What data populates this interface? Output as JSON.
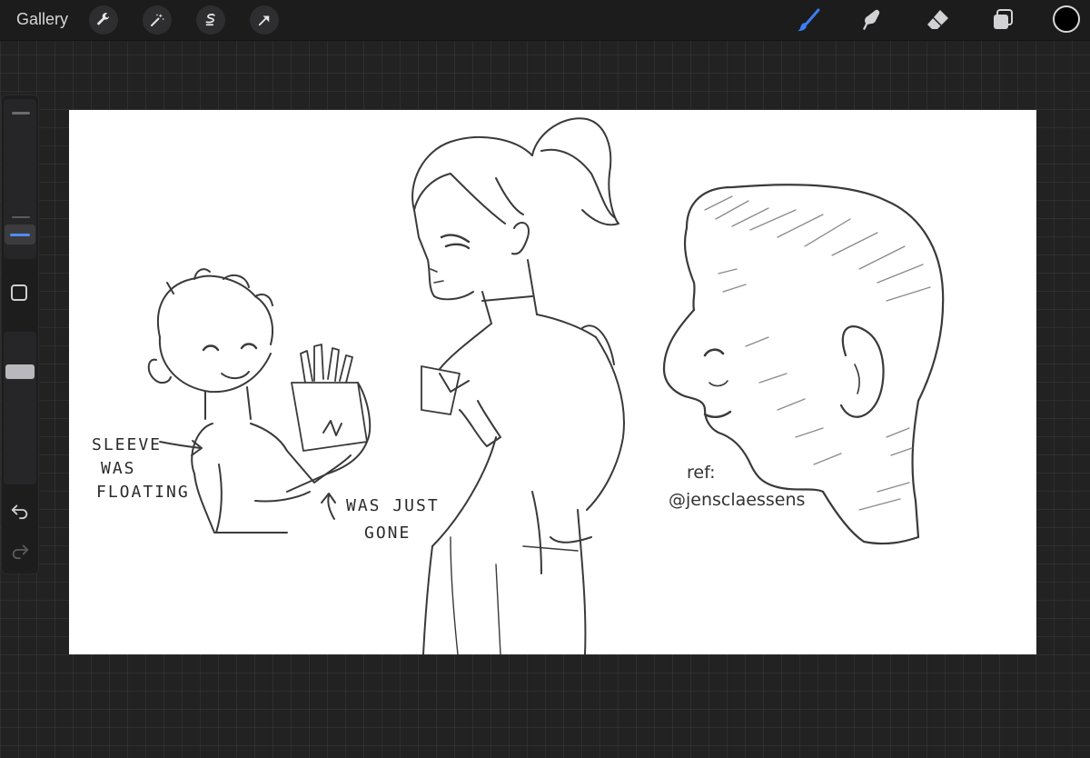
{
  "topbar": {
    "gallery_label": "Gallery",
    "left_tools": [
      "wrench-icon",
      "magic-wand-icon",
      "selection-icon",
      "transform-arrow-icon"
    ],
    "right_tools": [
      "brush-icon",
      "smudge-icon",
      "eraser-icon",
      "layers-icon"
    ],
    "active_tool": "brush",
    "accent_color": "#3c7ff0",
    "current_color": "#000000"
  },
  "sidebar": {
    "brush_size": 0.12,
    "brush_opacity": 0.82
  },
  "canvas": {
    "annotations": {
      "sleeve_line1": "SLEEVE",
      "sleeve_line2": "WAS",
      "sleeve_line3": "FLOATING",
      "gone_line1": "WAS JUST",
      "gone_line2": "GONE",
      "ref_line1": "ref:",
      "ref_line2": "@jensclaessens"
    }
  }
}
